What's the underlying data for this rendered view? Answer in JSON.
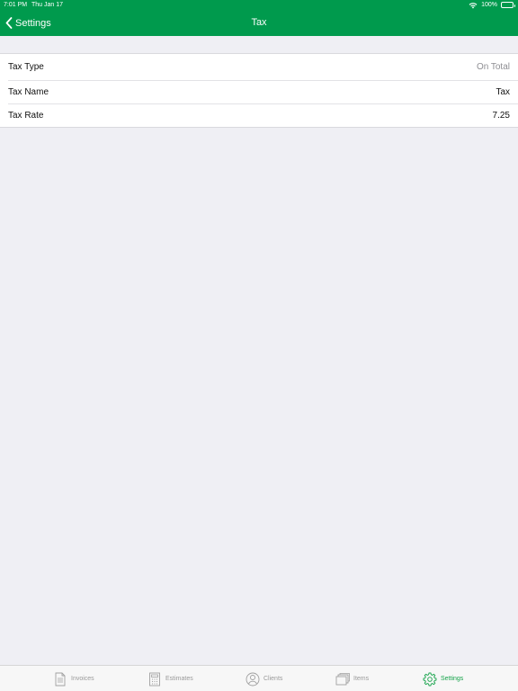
{
  "status_bar": {
    "time": "7:01 PM",
    "date": "Thu Jan 17",
    "battery": "100%"
  },
  "nav": {
    "back_label": "Settings",
    "title": "Tax"
  },
  "settings": {
    "rows": [
      {
        "label": "Tax Type",
        "value": "On Total"
      },
      {
        "label": "Tax Name",
        "value": "Tax"
      },
      {
        "label": "Tax Rate",
        "value": "7.25"
      }
    ]
  },
  "tabs": [
    {
      "label": "Invoices",
      "icon": "document-icon"
    },
    {
      "label": "Estimates",
      "icon": "calculator-icon"
    },
    {
      "label": "Clients",
      "icon": "person-icon"
    },
    {
      "label": "Items",
      "icon": "stack-icon"
    },
    {
      "label": "Settings",
      "icon": "gear-icon"
    }
  ],
  "colors": {
    "brand": "#009a4d",
    "active_tab": "#16a34a",
    "inactive_tab": "#9a9a9a",
    "background": "#efeff4"
  }
}
